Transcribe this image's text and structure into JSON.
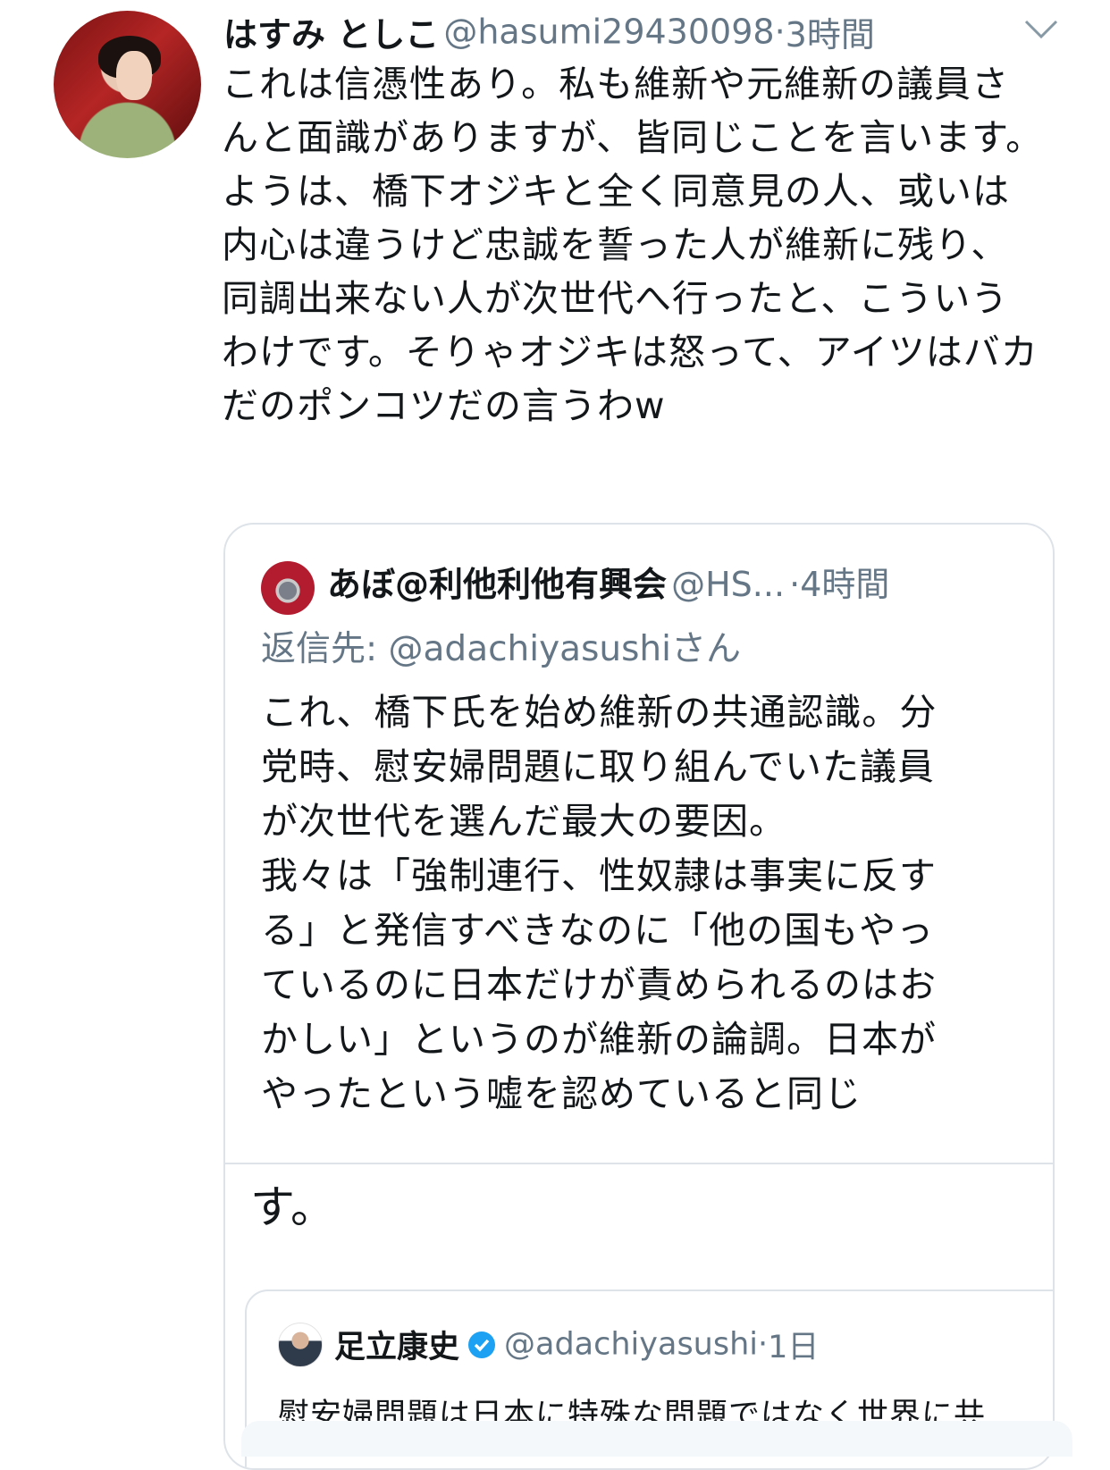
{
  "tweet": {
    "author_name": "はすみ としこ",
    "author_handle": "@hasumi29430098",
    "separator": "·",
    "time": "3時間",
    "body": "これは信憑性あり。私も維新や元維新の議員さんと面識がありますが、皆同じことを言います。ようは、橋下オジキと全く同意見の人、或いは内心は違うけど忠誠を誓った人が維新に残り、同調出来ない人が次世代へ行ったと、こういうわけです。そりゃオジキは怒って、アイツはバカだのポンコツだの言うわw"
  },
  "quoted_tweet": {
    "author_name": "あぼ@利他利他有興会",
    "author_handle": "@HS...",
    "separator": "·",
    "time": "4時間",
    "reply_to": "返信先: @adachiyasushiさん",
    "body": "これ、橋下氏を始め維新の共通認識。分\n党時、慰安婦問題に取り組んでいた議員\nが次世代を選んだ最大の要因。\n我々は「強制連行、性奴隷は事実に反す\nる」と発信すべきなのに「他の国もやっ\nているのに日本だけが責められるのはお\nかしい」というのが維新の論調。日本が\nやったという嘘を認めていると同じ",
    "tail": "す。"
  },
  "nested_quote": {
    "author_name": "足立康史",
    "author_handle": "@adachiyasushi",
    "separator": "·",
    "time": "1日",
    "body": "慰安婦問題は日本に特殊な問題ではなく世界に共"
  },
  "icons": {
    "chevron": "chevron-down-icon",
    "verified": "verified-badge-icon"
  },
  "colors": {
    "text": "#14171a",
    "muted": "#657786",
    "border": "#dde3e8",
    "verified": "#1da1f2"
  }
}
